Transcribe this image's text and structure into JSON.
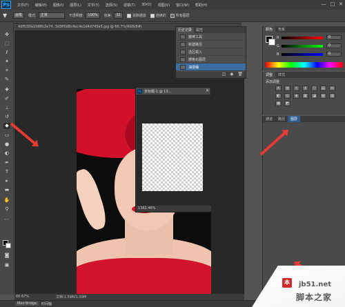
{
  "app": {
    "logo": "Ps",
    "menu": [
      "文件(F)",
      "编辑(E)",
      "图像(I)",
      "图层(L)",
      "文字(Y)",
      "选择(S)",
      "滤镜(T)",
      "3D(D)",
      "视图(V)",
      "窗口(W)",
      "帮助(H)"
    ],
    "window_controls": [
      "—",
      "□",
      "✕"
    ]
  },
  "options_bar": {
    "preset": "画笔",
    "mode_label": "模式:",
    "mode_value": "正常",
    "opacity_label": "不透明度:",
    "opacity_value": "100%",
    "tolerance_label": "容差:",
    "tolerance_value": "32",
    "antialias_label": "消除锯齿",
    "contiguous_label": "连续的",
    "all_layers_label": "所有图层"
  },
  "document": {
    "tab_title": "4df530la1fd8fc2e74..3d3ff0d8c4ec4e1d4d745e5.jpg @ 66.7%(RGB/8#)",
    "zoom": "66.67%",
    "doc_size": "文档:1.59M/1.59M"
  },
  "mini_window": {
    "title": "未标题-1 @ 13...",
    "zoom": "1382.46%"
  },
  "history_panel": {
    "tabs": [
      "历史记录",
      "属性"
    ],
    "items": [
      "魔棒工具",
      "新建路径",
      "选区载入",
      "栅格化图层",
      "油漆桶"
    ],
    "active_index": 4
  },
  "color_panel": {
    "tabs": [
      "颜色",
      "色板"
    ],
    "channels": [
      {
        "label": "R",
        "value": "0",
        "color": "#ff3030"
      },
      {
        "label": "G",
        "value": "0",
        "color": "#30c030"
      },
      {
        "label": "B",
        "value": "0",
        "color": "#3050ff"
      }
    ]
  },
  "adjustments_panel": {
    "tabs": [
      "调整",
      "样式"
    ],
    "heading": "添加调整"
  },
  "layers_panel": {
    "tabs": [
      "通道",
      "路径",
      "图层"
    ],
    "active_tab": "图层"
  },
  "bottom_bar": {
    "mini_bridge": "Mini Bridge",
    "timeline": "时间轴"
  },
  "watermark": {
    "site": "jb51.net",
    "brand": "脚本之家"
  },
  "colors": {
    "accent_arrow": "#e63a35",
    "selection_blue": "#3b6da3",
    "ui_dark": "#282828"
  }
}
